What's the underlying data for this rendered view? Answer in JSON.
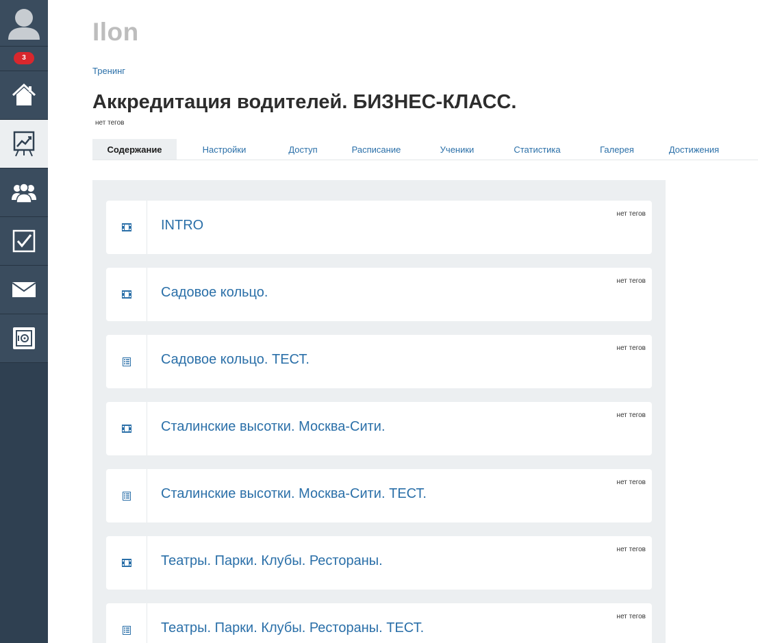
{
  "sidebar": {
    "badge": "3",
    "items": [
      {
        "name": "home-icon"
      },
      {
        "name": "training-chart-icon",
        "active": true
      },
      {
        "name": "users-group-icon"
      },
      {
        "name": "tasks-checkbox-icon"
      },
      {
        "name": "mail-icon"
      },
      {
        "name": "safe-icon"
      }
    ]
  },
  "header": {
    "app_title": "Ilon",
    "breadcrumb": "Тренинг",
    "page_title": "Аккредитация водителей. БИЗНЕС-КЛАСС.",
    "tags": "нет тегов"
  },
  "tabs": [
    {
      "label": "Содержание",
      "active": true
    },
    {
      "label": "Настройки"
    },
    {
      "label": "Доступ"
    },
    {
      "label": "Расписание"
    },
    {
      "label": "Ученики"
    },
    {
      "label": "Статистика"
    },
    {
      "label": "Галерея"
    },
    {
      "label": "Достижения"
    }
  ],
  "lessons": [
    {
      "title": "INTRO",
      "icon": "film-icon",
      "tags": "нет тегов"
    },
    {
      "title": "Садовое кольцо.",
      "icon": "film-icon",
      "tags": "нет тегов"
    },
    {
      "title": "Садовое кольцо. ТЕСТ.",
      "icon": "test-list-icon",
      "tags": "нет тегов"
    },
    {
      "title": "Сталинские высотки. Москва-Сити.",
      "icon": "film-icon",
      "tags": "нет тегов"
    },
    {
      "title": "Сталинские высотки. Москва-Сити. ТЕСТ.",
      "icon": "test-list-icon",
      "tags": "нет тегов"
    },
    {
      "title": "Театры. Парки. Клубы. Рестораны.",
      "icon": "film-icon",
      "tags": "нет тегов"
    },
    {
      "title": "Театры. Парки. Клубы. Рестораны. ТЕСТ.",
      "icon": "test-list-icon",
      "tags": "нет тегов"
    }
  ],
  "colors": {
    "sidebar_bg": "#2f4051",
    "sidebar_item_bg": "#3a4c5e",
    "link": "#2a6fa8",
    "badge": "#d9272d",
    "panel_bg": "#eceff1"
  }
}
